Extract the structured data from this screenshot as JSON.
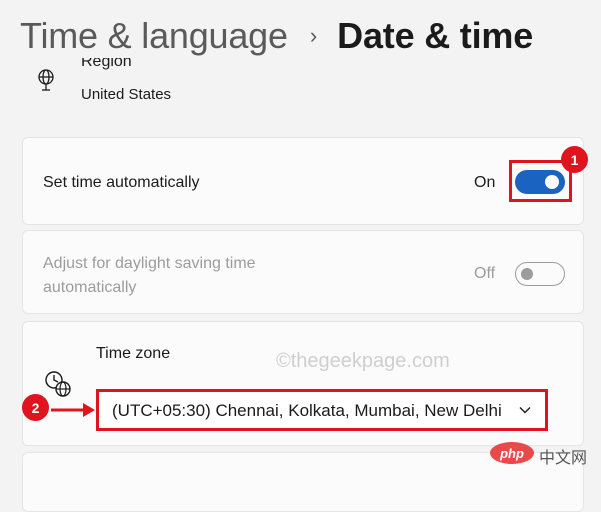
{
  "breadcrumb": {
    "parent": "Time & language",
    "separator": "›",
    "current": "Date & time"
  },
  "region": {
    "title": "Region",
    "value": "United States",
    "icon": "globe-icon"
  },
  "set_time_automatically": {
    "label": "Set time automatically",
    "state": "On",
    "enabled": true
  },
  "daylight_saving": {
    "label": "Adjust for daylight saving time automatically",
    "state": "Off",
    "enabled": false
  },
  "time_zone": {
    "label": "Time zone",
    "value": "(UTC+05:30) Chennai, Kolkata, Mumbai, New Delhi",
    "icon": "clock-globe-icon"
  },
  "annotations": {
    "badge_1": "1",
    "badge_2": "2",
    "highlight_color": "#e0141e"
  },
  "watermark": "©thegeekpage.com",
  "php_logo": {
    "badge": "php",
    "text": "中文网"
  },
  "colors": {
    "accent": "#1a63c0",
    "background": "#f3f3f3",
    "card": "#fbfbfb",
    "disabled_text": "#9c9c9c"
  }
}
